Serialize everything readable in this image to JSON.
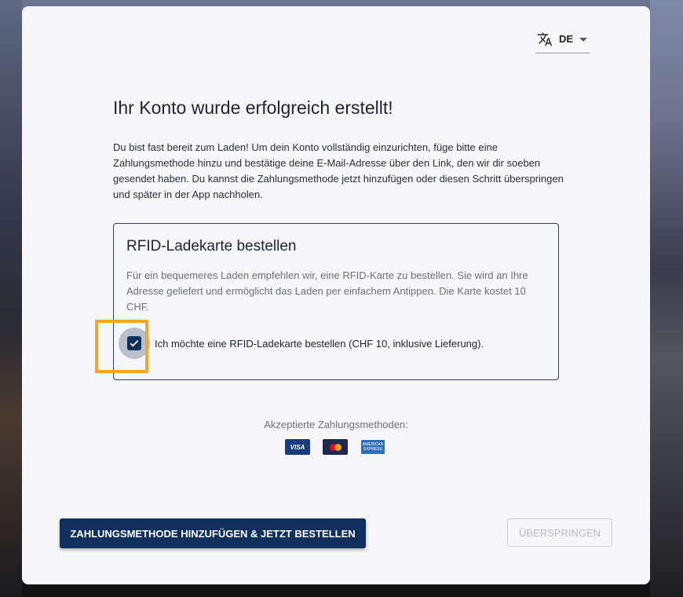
{
  "language": {
    "code": "DE",
    "icon": "translate-icon"
  },
  "title": "Ihr Konto wurde erfolgreich erstellt!",
  "intro": "Du bist fast bereit zum Laden! Um dein Konto vollständig einzurichten, füge bitte eine Zahlungsmethode hinzu und bestätige deine E-Mail-Adresse über den Link, den wir dir soeben gesendet haben. Du kannst die Zahlungsmethode jetzt hinzufügen oder diesen Schritt überspringen und später in der App nachholen.",
  "rfid": {
    "heading": "RFID-Ladekarte bestellen",
    "description": "Für ein bequemeres Laden empfehlen wir, eine RFID-Karte zu bestellen. Sie wird an Ihre Adresse geliefert und ermöglicht das Laden per einfachem Antippen. Die Karte kostet 10 CHF.",
    "checkbox_label": "Ich möchte eine RFID-Ladekarte bestellen (CHF 10, inklusive Lieferung).",
    "checked": true
  },
  "payment": {
    "label": "Akzeptierte Zahlungsmethoden:",
    "methods": [
      "visa-icon",
      "mastercard-icon",
      "amex-icon"
    ],
    "visa_text": "VISA",
    "amex_text": "AMERICAN EXPRESS"
  },
  "buttons": {
    "primary": "ZAHLUNGSMETHODE HINZUFÜGEN & JETZT BESTELLEN",
    "skip": "ÜBERSPRINGEN"
  },
  "colors": {
    "primary": "#0f2f5c",
    "highlight": "#f5a623"
  }
}
